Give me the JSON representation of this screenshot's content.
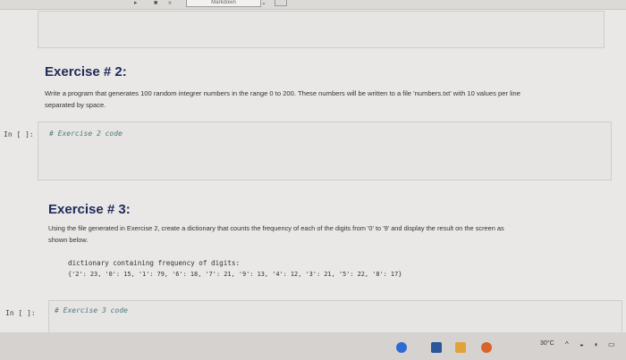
{
  "toolbar": {
    "cell_type": "Markdown"
  },
  "cells": {
    "top_code_prompt": "",
    "exercise2": {
      "title": "Exercise # 2:",
      "description_line1": "Write a program that generates 100 random integrer numbers in the range 0 to 200. These numbers will be written to a file 'numbers.txt' with 10 values per line",
      "description_line2": "separated by space.",
      "prompt": "In [ ]:",
      "code": "# Exercise 2 code"
    },
    "exercise3": {
      "title": "Exercise # 3:",
      "description_line1": "Using the file generated in Exercise 2, create a dictionary that counts the frequency of each of the digits from '0' to '9' and display the result on the screen as",
      "description_line2": "shown below.",
      "sample_output_line1": "dictionary containing frequency of digits:",
      "sample_output_line2": "{'2': 23, '0': 15, '1': 79, '6': 18, '7': 21, '9': 13, '4': 12, '3': 21, '5': 22, '8': 17}",
      "prompt": "In [ ]:",
      "code": "# Exercise 3 code"
    }
  },
  "taskbar": {
    "temperature": "30°C",
    "icons": [
      "chrome-icon",
      "word-icon",
      "file-explorer-icon",
      "matlab-icon"
    ]
  },
  "colors": {
    "title": "#1e2a5a",
    "comment": "#4d7a7a"
  }
}
